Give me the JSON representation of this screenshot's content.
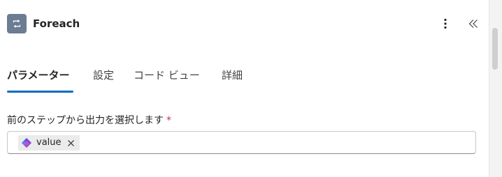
{
  "header": {
    "title": "Foreach",
    "action_icon": "loop-icon",
    "action_icon_color": "#6b7c93"
  },
  "tabs": [
    {
      "label": "パラメーター",
      "active": true
    },
    {
      "label": "設定",
      "active": false
    },
    {
      "label": "コード ビュー",
      "active": false
    },
    {
      "label": "詳細",
      "active": false
    }
  ],
  "field": {
    "label": "前のステップから出力を選択します",
    "required_mark": "*",
    "token": {
      "label": "value",
      "icon": "dynamic-content-icon"
    }
  },
  "colors": {
    "accent": "#0f6cbd",
    "required": "#c4314b"
  }
}
